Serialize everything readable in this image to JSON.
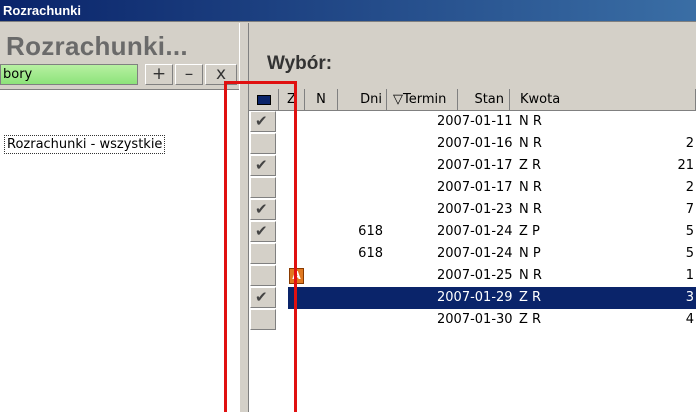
{
  "window": {
    "title": "Rozrachunki"
  },
  "left_panel": {
    "title": "Rozrachunki...",
    "filter_label": "bory",
    "add_button": "+",
    "remove_button": "–",
    "close_button": "x",
    "items": [
      "Rozrachunki - wszystkie"
    ]
  },
  "right_panel": {
    "title": "Wybór:",
    "columns": [
      "",
      "Z",
      "N",
      "Dni",
      "▽Termin",
      "Stan",
      "Kwota"
    ],
    "rows": [
      {
        "checked": true,
        "flag": "",
        "dni": "",
        "termin": "2007-01-11",
        "stan": "N R",
        "kwota": "",
        "selected": false
      },
      {
        "checked": false,
        "flag": "",
        "dni": "",
        "termin": "2007-01-16",
        "stan": "N R",
        "kwota": "2",
        "selected": false
      },
      {
        "checked": true,
        "flag": "",
        "dni": "",
        "termin": "2007-01-17",
        "stan": "Z R",
        "kwota": "21",
        "selected": false
      },
      {
        "checked": false,
        "flag": "",
        "dni": "",
        "termin": "2007-01-17",
        "stan": "N R",
        "kwota": "2",
        "selected": false
      },
      {
        "checked": true,
        "flag": "",
        "dni": "",
        "termin": "2007-01-23",
        "stan": "N R",
        "kwota": "7",
        "selected": false
      },
      {
        "checked": true,
        "flag": "",
        "dni": "618",
        "termin": "2007-01-24",
        "stan": "Z P",
        "kwota": "5",
        "selected": false
      },
      {
        "checked": false,
        "flag": "",
        "dni": "618",
        "termin": "2007-01-24",
        "stan": "N P",
        "kwota": "5",
        "selected": false
      },
      {
        "checked": false,
        "flag": "A",
        "dni": "",
        "termin": "2007-01-25",
        "stan": "N R",
        "kwota": "1",
        "selected": false
      },
      {
        "checked": true,
        "flag": "",
        "dni": "",
        "termin": "2007-01-29",
        "stan": "Z R",
        "kwota": "3",
        "selected": true
      },
      {
        "checked": false,
        "flag": "",
        "dni": "",
        "termin": "2007-01-30",
        "stan": "Z R",
        "kwota": "4",
        "selected": false
      }
    ]
  },
  "colors": {
    "highlight_box": "#e01010",
    "selection": "#0a246a",
    "filter_green": "#a6ea90"
  }
}
